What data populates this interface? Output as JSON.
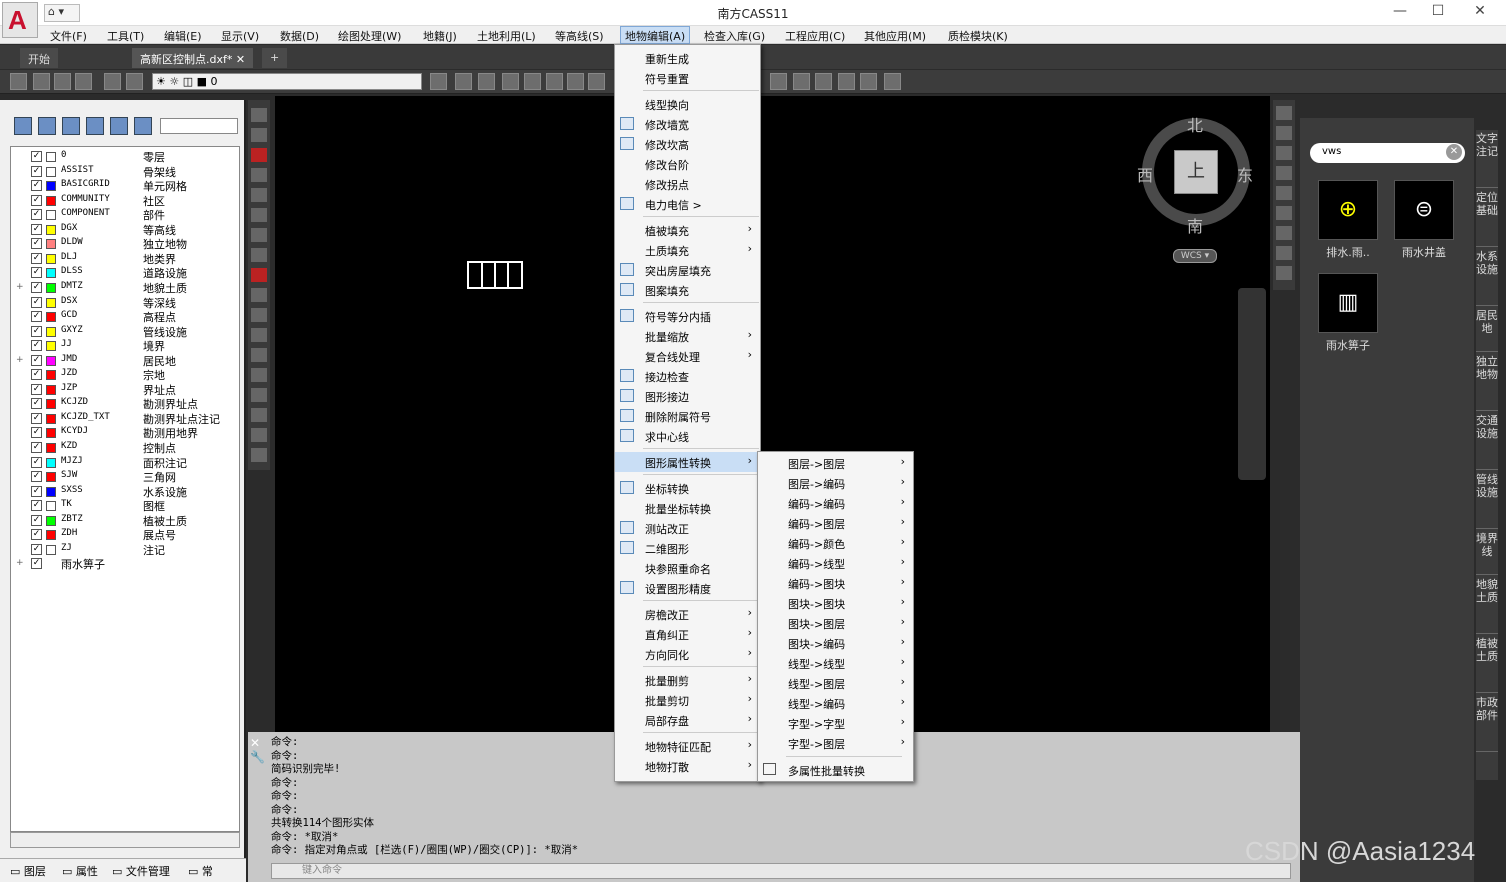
{
  "app": {
    "title": "南方CASS11",
    "quick_access": "▾",
    "min": "—",
    "max": "☐",
    "close": "✕"
  },
  "menubar": [
    "文件(F)",
    "工具(T)",
    "编辑(E)",
    "显示(V)",
    "数据(D)",
    "绘图处理(W)",
    "地籍(J)",
    "土地利用(L)",
    "等高线(S)",
    "地物编辑(A)",
    "检查入库(G)",
    "工程应用(C)",
    "其他应用(M)",
    "质检模块(K)"
  ],
  "menubar_active": "地物编辑(A)",
  "tabs": {
    "start": "开始",
    "doc": "高新区控制点.dxf*",
    "doc_close": "✕",
    "add": "+"
  },
  "layer_combo": "0",
  "layers": [
    {
      "name": "0",
      "desc": "零层",
      "color": "#ffffff"
    },
    {
      "name": "ASSIST",
      "desc": "骨架线",
      "color": "#ffffff"
    },
    {
      "name": "BASICGRID",
      "desc": "单元网格",
      "color": "#0000ff"
    },
    {
      "name": "COMMUNITY",
      "desc": "社区",
      "color": "#ff0000"
    },
    {
      "name": "COMPONENT",
      "desc": "部件",
      "color": "#ffffff"
    },
    {
      "name": "DGX",
      "desc": "等高线",
      "color": "#ffff00"
    },
    {
      "name": "DLDW",
      "desc": "独立地物",
      "color": "#ff8080"
    },
    {
      "name": "DLJ",
      "desc": "地类界",
      "color": "#ffff00"
    },
    {
      "name": "DLSS",
      "desc": "道路设施",
      "color": "#00ffff"
    },
    {
      "name": "DMTZ",
      "desc": "地貌土质",
      "color": "#00ff00",
      "expand": "+"
    },
    {
      "name": "DSX",
      "desc": "等深线",
      "color": "#ffff00"
    },
    {
      "name": "GCD",
      "desc": "高程点",
      "color": "#ff0000"
    },
    {
      "name": "GXYZ",
      "desc": "管线设施",
      "color": "#ffff00"
    },
    {
      "name": "JJ",
      "desc": "境界",
      "color": "#ffff00"
    },
    {
      "name": "JMD",
      "desc": "居民地",
      "color": "#ff00ff",
      "expand": "+"
    },
    {
      "name": "JZD",
      "desc": "宗地",
      "color": "#ff0000"
    },
    {
      "name": "JZP",
      "desc": "界址点",
      "color": "#ff0000"
    },
    {
      "name": "KCJZD",
      "desc": "勘测界址点",
      "color": "#ff0000"
    },
    {
      "name": "KCJZD_TXT",
      "desc": "勘测界址点注记",
      "color": "#ff0000"
    },
    {
      "name": "KCYDJ",
      "desc": "勘测用地界",
      "color": "#ff0000"
    },
    {
      "name": "KZD",
      "desc": "控制点",
      "color": "#ff0000"
    },
    {
      "name": "MJZJ",
      "desc": "面积注记",
      "color": "#00ffff"
    },
    {
      "name": "SJW",
      "desc": "三角网",
      "color": "#ff0000"
    },
    {
      "name": "SXSS",
      "desc": "水系设施",
      "color": "#0000ff"
    },
    {
      "name": "TK",
      "desc": "图框",
      "color": "#ffffff"
    },
    {
      "name": "ZBTZ",
      "desc": "植被土质",
      "color": "#00ff00"
    },
    {
      "name": "ZDH",
      "desc": "展点号",
      "color": "#ff0000"
    },
    {
      "name": "ZJ",
      "desc": "注记",
      "color": "#ffffff"
    },
    {
      "name": "",
      "desc": "雨水箅子",
      "color": "",
      "expand": "+"
    }
  ],
  "check_mark": "✓",
  "left_tabs": [
    "图层",
    "属性",
    "文件管理",
    "常"
  ],
  "compass": {
    "n": "北",
    "s": "南",
    "e": "东",
    "w": "西",
    "center": "上",
    "wcs": "WCS ▾"
  },
  "command_lines": [
    "命令:",
    "命令:",
    "简码识别完毕!",
    "命令:",
    "命令:",
    "命令:",
    "共转换114个图形实体",
    "命令: *取消*",
    "命令: 指定对角点或 [栏选(F)/圈围(WP)/圈交(CP)]: *取消*"
  ],
  "command_placeholder": "键入命令",
  "palette": {
    "search": "vws",
    "tiles": [
      "排水.雨..",
      "雨水井盖",
      "雨水箅子"
    ],
    "side_tabs": [
      "文字注记",
      "定位基础",
      "水系设施",
      "居民地",
      "独立地物",
      "交通设施",
      "管线设施",
      "境界线",
      "地貌土质",
      "植被土质",
      "市政部件"
    ]
  },
  "menu1": [
    {
      "label": "重新生成"
    },
    {
      "label": "符号重置"
    },
    {
      "sep": true
    },
    {
      "label": "线型换向"
    },
    {
      "label": "修改墙宽",
      "icon": true
    },
    {
      "label": "修改坎高",
      "icon": true
    },
    {
      "label": "修改台阶"
    },
    {
      "label": "修改拐点"
    },
    {
      "label": "电力电信 >",
      "icon": true
    },
    {
      "sep": true
    },
    {
      "label": "植被填充",
      "arrow": true
    },
    {
      "label": "土质填充",
      "arrow": true
    },
    {
      "label": "突出房屋填充",
      "icon": true
    },
    {
      "label": "图案填充",
      "icon": true
    },
    {
      "sep": true
    },
    {
      "label": "符号等分内插",
      "icon": true
    },
    {
      "label": "批量缩放",
      "arrow": true
    },
    {
      "label": "复合线处理",
      "arrow": true
    },
    {
      "label": "接边检查",
      "icon": true
    },
    {
      "label": "图形接边",
      "icon": true
    },
    {
      "label": "删除附属符号",
      "icon": true
    },
    {
      "label": "求中心线",
      "icon": true
    },
    {
      "sep": true
    },
    {
      "label": "图形属性转换",
      "arrow": true,
      "hl": true
    },
    {
      "sep": true
    },
    {
      "label": "坐标转换",
      "icon": true
    },
    {
      "label": "批量坐标转换"
    },
    {
      "label": "测站改正",
      "icon": true
    },
    {
      "label": "二维图形",
      "icon": true
    },
    {
      "label": "块参照重命名"
    },
    {
      "label": "设置图形精度",
      "icon": true
    },
    {
      "sep": true
    },
    {
      "label": "房檐改正",
      "arrow": true
    },
    {
      "label": "直角纠正",
      "arrow": true
    },
    {
      "label": "方向同化",
      "arrow": true
    },
    {
      "sep": true
    },
    {
      "label": "批量删剪",
      "arrow": true
    },
    {
      "label": "批量剪切",
      "arrow": true
    },
    {
      "label": "局部存盘",
      "arrow": true
    },
    {
      "sep": true
    },
    {
      "label": "地物特征匹配",
      "arrow": true
    },
    {
      "label": "地物打散",
      "arrow": true
    }
  ],
  "menu2": [
    "图层->图层",
    "图层->编码",
    "编码->编码",
    "编码->图层",
    "编码->颜色",
    "编码->线型",
    "编码->图块",
    "图块->图块",
    "图块->图层",
    "图块->编码",
    "线型->线型",
    "线型->图层",
    "线型->编码",
    "字型->字型",
    "字型->图层"
  ],
  "menu2_last": "多属性批量转换",
  "arrow_glyph": "›",
  "watermark": "CSDN @Aasia1234",
  "colors": {
    "menu_highlight": "#c9def5",
    "canvas": "#000000",
    "panel": "#3b3b3b"
  }
}
